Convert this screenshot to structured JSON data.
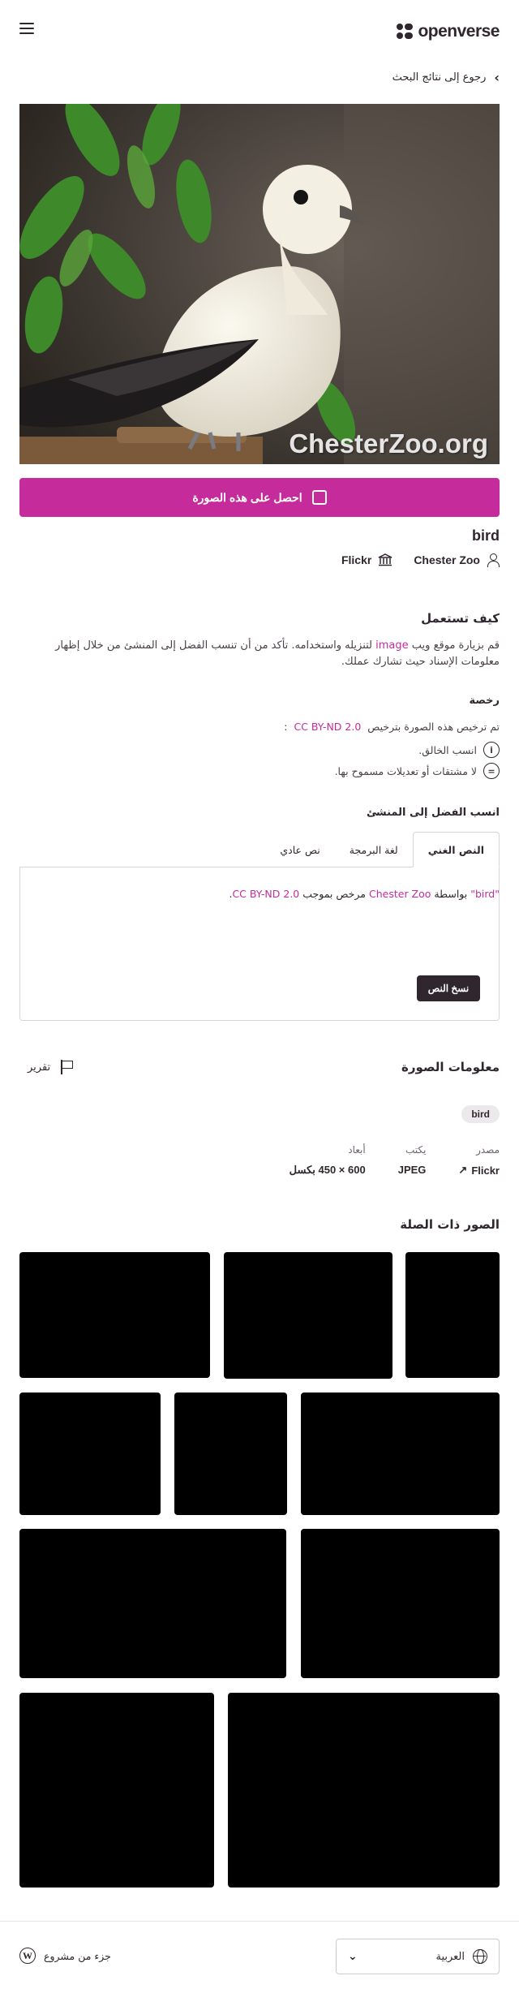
{
  "header": {
    "logo_text": "openverse",
    "menu_icon": "hamburger-menu-icon",
    "back_link": "رجوع إلى نتائج البحث"
  },
  "image": {
    "watermark": "ChesterZoo.org",
    "download_label": "احصل على هذه الصورة",
    "title": "bird",
    "creator": "Chester Zoo",
    "source": "Flickr"
  },
  "how_to_use": {
    "heading": "كيف تستعمل",
    "text_before": "قم بزيارة موقع ويب",
    "text_link": "image",
    "text_after": "لتنزيله واستخدامه. تأكد من أن تنسب الفضل إلى المنشئ من خلال إظهار معلومات الإسناد حيث تشارك عملك."
  },
  "license": {
    "heading": "رخصة",
    "intro": "تم ترخيص هذه الصورة بترخيص",
    "license_name": "CC BY-ND 2.0",
    "colon": ":",
    "items": [
      {
        "icon": "cc-by-icon",
        "text": "انسب الخالق."
      },
      {
        "icon": "cc-nd-icon",
        "text": "لا مشتقات أو تعديلات مسموح بها."
      }
    ]
  },
  "attribution": {
    "heading": "انسب الفضل إلى المنشئ",
    "tabs": [
      "النص الغني",
      "لغة البرمجة",
      "نص عادي"
    ],
    "active_tab": 0,
    "quote_title": "\"bird\"",
    "by": "بواسطة",
    "creator": "Chester Zoo",
    "licensed": "مرخص بموجب",
    "license_name": "CC BY-ND 2.0",
    "period": ".",
    "copy_label": "نسخ النص"
  },
  "info": {
    "heading": "معلومات الصورة",
    "report_label": "تقرير",
    "tag": "bird",
    "source_label": "مصدر",
    "source_value": "Flickr",
    "type_label": "يكتب",
    "type_value": "JPEG",
    "dims_label": "أبعاد",
    "dims_value": "600 × 450 بكسل"
  },
  "related": {
    "heading": "الصور ذات الصلة",
    "count": 9
  },
  "footer": {
    "language": "العربية",
    "credit": "جزء من مشروع"
  }
}
